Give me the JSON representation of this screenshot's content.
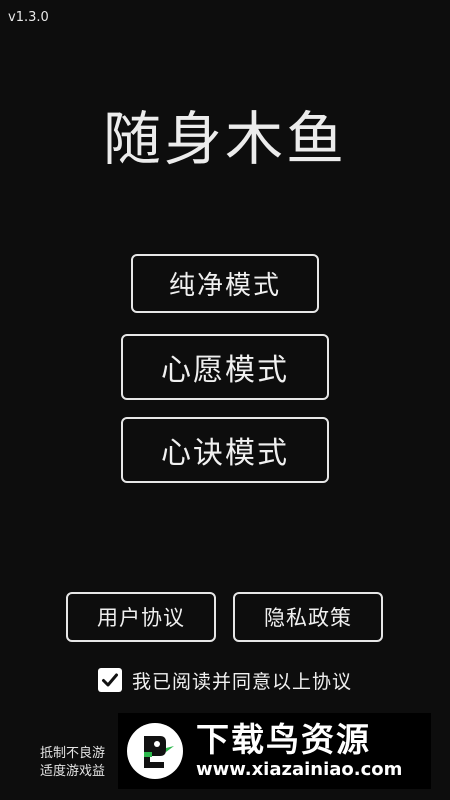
{
  "version": "v1.3.0",
  "app_title": "随身木鱼",
  "modes": {
    "pure": "纯净模式",
    "wish": "心愿模式",
    "mantra": "心诀模式"
  },
  "links": {
    "user_agreement": "用户协议",
    "privacy_policy": "隐私政策"
  },
  "agreement": {
    "checked": true,
    "text": "我已阅读并同意以上协议"
  },
  "notice": {
    "line1": "抵制不良游",
    "line2": "适度游戏益"
  },
  "watermark": {
    "name": "下载鸟资源",
    "url": "www.xiazainiao.com",
    "logo_icon": "bird-logo-icon"
  },
  "colors": {
    "background": "#0d0d0d",
    "border": "#e6e6e6",
    "text": "#f0f0f0",
    "logo_green": "#2db84d"
  }
}
